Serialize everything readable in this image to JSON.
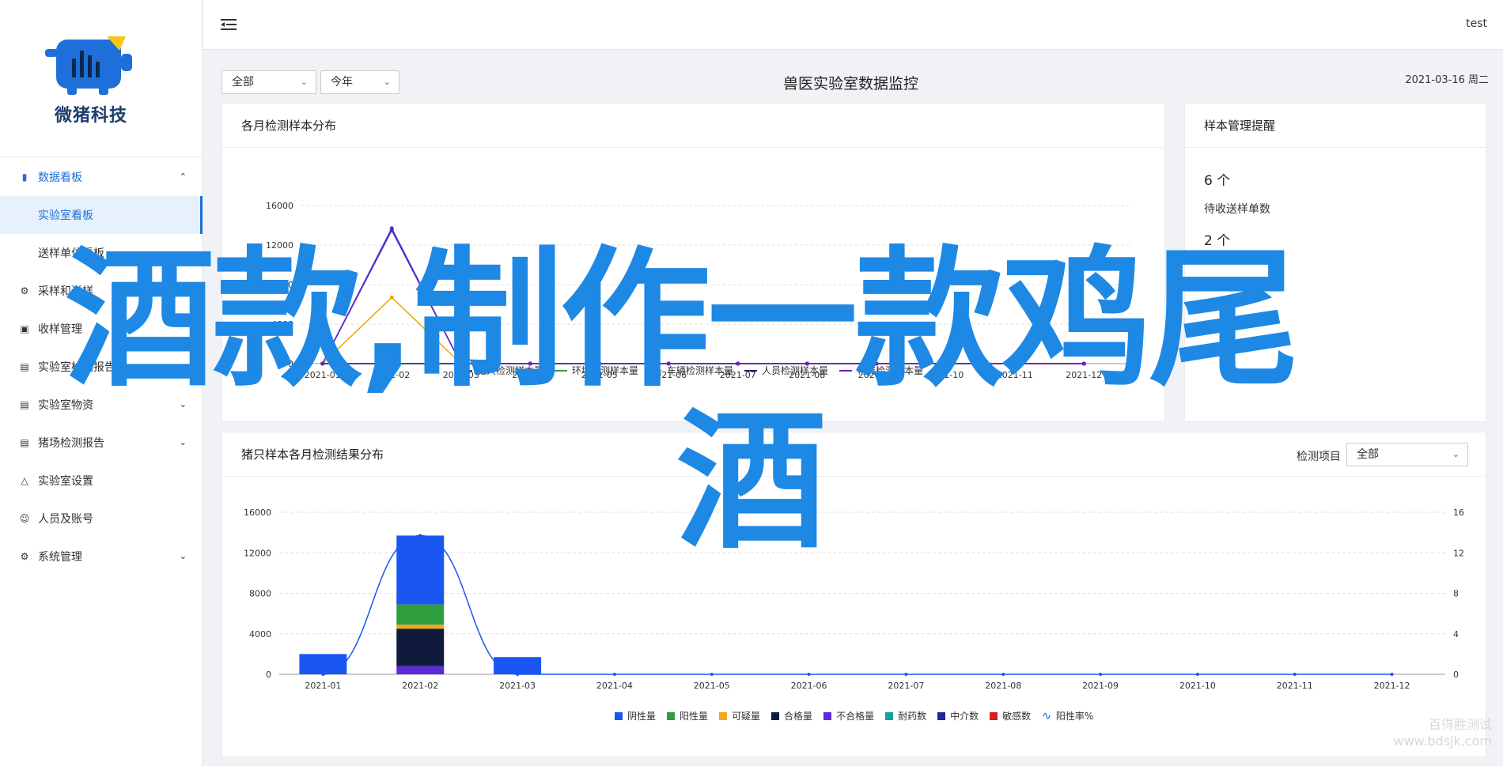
{
  "brand": {
    "name": "微猪科技"
  },
  "header": {
    "user": "test"
  },
  "sidebar": {
    "items": [
      {
        "label": "数据看板",
        "icon": "bar-chart-icon",
        "expanded": true
      },
      {
        "label": "实验室看板",
        "sub": true,
        "active": true
      },
      {
        "label": "送样单位看板",
        "sub": true
      },
      {
        "label": "采样和送样",
        "icon": "sample-icon"
      },
      {
        "label": "收样管理",
        "icon": "inbox-icon"
      },
      {
        "label": "实验室检测报告",
        "icon": "document-icon",
        "expandable": true
      },
      {
        "label": "实验室物资",
        "icon": "clipboard-icon",
        "expandable": true
      },
      {
        "label": "猪场检测报告",
        "icon": "report-icon",
        "expandable": true
      },
      {
        "label": "实验室设置",
        "icon": "flask-icon"
      },
      {
        "label": "人员及账号",
        "icon": "user-icon"
      },
      {
        "label": "系统管理",
        "icon": "gear-icon",
        "expandable": true
      }
    ]
  },
  "filters": {
    "scope": "全部",
    "period": "今年"
  },
  "page": {
    "title": "兽医实验室数据监控",
    "date": "2021-03-16 周二"
  },
  "card_monthly": {
    "title": "各月检测样本分布"
  },
  "card_reminder": {
    "title": "样本管理提醒",
    "value1": "6 个",
    "label1": "待收送样单数",
    "value2": "2 个"
  },
  "card_results": {
    "title": "猪只样本各月检测结果分布",
    "filter_label": "检测项目",
    "filter_value": "全部"
  },
  "overlay": {
    "line1": "酒款,制作一款鸡尾",
    "line2": "酒"
  },
  "watermark": {
    "line1": "百得胜测试",
    "line2": "www.bdsjk.com"
  },
  "chart_data": [
    {
      "type": "line",
      "title": "各月检测样本分布",
      "categories": [
        "2021-01",
        "2021-02",
        "2021-03",
        "2021-04",
        "2021-05",
        "2021-06",
        "2021-07",
        "2021-08",
        "2021-09",
        "2021-10",
        "2021-11",
        "2021-12"
      ],
      "yticks": [
        0,
        4000,
        8000,
        12000,
        16000
      ],
      "ylim": [
        0,
        16000
      ],
      "series": [
        {
          "name": "猪只检测样本量",
          "color": "#1f4fd8",
          "values": [
            0,
            13700,
            0,
            0,
            0,
            0,
            0,
            0,
            0,
            0,
            0,
            0
          ]
        },
        {
          "name": "环境检测样本量",
          "color": "#2f9e44",
          "values": [
            0,
            0,
            0,
            0,
            0,
            0,
            0,
            0,
            0,
            0,
            0,
            0
          ]
        },
        {
          "name": "车辆检测样本量",
          "color": "#f0a500",
          "values": [
            0,
            6700,
            0,
            0,
            0,
            0,
            0,
            0,
            0,
            0,
            0,
            0
          ]
        },
        {
          "name": "人员检测样本量",
          "color": "#1a237e",
          "values": [
            0,
            0,
            0,
            0,
            0,
            0,
            0,
            0,
            0,
            0,
            0,
            0
          ]
        },
        {
          "name": "物资检测样本量",
          "color": "#6a1fc2",
          "values": [
            0,
            13500,
            0,
            0,
            0,
            0,
            0,
            0,
            0,
            0,
            0,
            0
          ]
        }
      ],
      "legend": "bottom"
    },
    {
      "type": "bar",
      "stacked": true,
      "title": "猪只样本各月检测结果分布",
      "categories": [
        "2021-01",
        "2021-02",
        "2021-03",
        "2021-04",
        "2021-05",
        "2021-06",
        "2021-07",
        "2021-08",
        "2021-09",
        "2021-10",
        "2021-11",
        "2021-12"
      ],
      "yticks": [
        0,
        4000,
        8000,
        12000,
        16000
      ],
      "ylim": [
        0,
        16000
      ],
      "y2ticks": [
        0,
        4,
        8,
        12,
        16
      ],
      "y2lim": [
        0,
        16
      ],
      "series": [
        {
          "name": "阴性量",
          "color": "#1a56f0",
          "values": [
            2000,
            6800,
            1700,
            0,
            0,
            0,
            0,
            0,
            0,
            0,
            0,
            0
          ]
        },
        {
          "name": "阳性量",
          "color": "#2e9e3e",
          "values": [
            0,
            2000,
            0,
            0,
            0,
            0,
            0,
            0,
            0,
            0,
            0,
            0
          ]
        },
        {
          "name": "可疑量",
          "color": "#f5a623",
          "values": [
            0,
            400,
            0,
            0,
            0,
            0,
            0,
            0,
            0,
            0,
            0,
            0
          ]
        },
        {
          "name": "合格量",
          "color": "#101a3d",
          "values": [
            0,
            3700,
            0,
            0,
            0,
            0,
            0,
            0,
            0,
            0,
            0,
            0
          ]
        },
        {
          "name": "不合格量",
          "color": "#5b2bd6",
          "values": [
            0,
            800,
            0,
            0,
            0,
            0,
            0,
            0,
            0,
            0,
            0,
            0
          ]
        },
        {
          "name": "耐药数",
          "color": "#179f9a",
          "values": [
            0,
            0,
            0,
            0,
            0,
            0,
            0,
            0,
            0,
            0,
            0,
            0
          ]
        },
        {
          "name": "中介数",
          "color": "#1a2a9c",
          "values": [
            0,
            0,
            0,
            0,
            0,
            0,
            0,
            0,
            0,
            0,
            0,
            0
          ]
        },
        {
          "name": "敏感数",
          "color": "#d81e1e",
          "values": [
            0,
            0,
            0,
            0,
            0,
            0,
            0,
            0,
            0,
            0,
            0,
            0
          ]
        }
      ],
      "line": {
        "name": "阳性率%",
        "color": "#1a56f0",
        "axis": "right",
        "values": [
          0,
          13.7,
          0,
          0,
          0,
          0,
          0,
          0,
          0,
          0,
          0,
          0
        ]
      },
      "legend": "bottom"
    }
  ]
}
